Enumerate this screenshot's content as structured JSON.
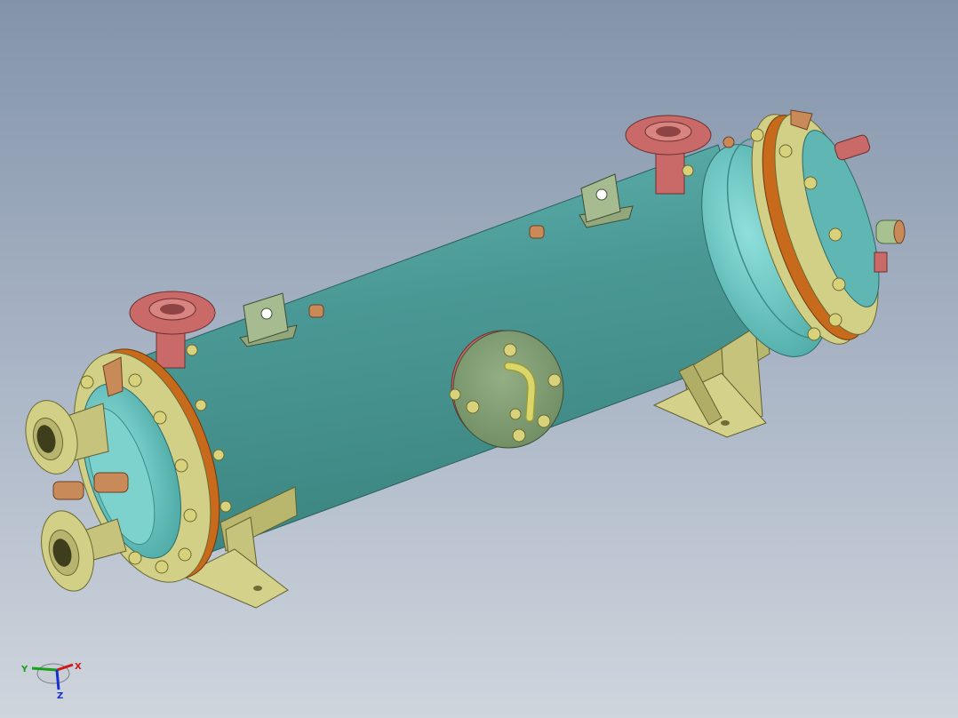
{
  "viewport": {
    "background_top": "#8394aa",
    "background_bottom": "#cfd5dd"
  },
  "model": {
    "parts": [
      "shell",
      "left-head",
      "right-head",
      "left-flange",
      "right-flange",
      "nozzle-top-left",
      "nozzle-top-right",
      "nozzle-left-upper",
      "nozzle-left-lower",
      "manhole-cover",
      "saddle-support-left",
      "saddle-support-right",
      "lifting-lug-left",
      "lifting-lug-right"
    ],
    "colors": {
      "shell": "#4a9895",
      "head": "#6cc8c4",
      "flange": "#d2cf86",
      "gasket": "#c86a1c",
      "nozzle": "#c96a68",
      "support": "#c6c47c",
      "lug": "#93a77d",
      "copper": "#c98a5a",
      "cover": "#7f9b70",
      "handle": "#d9d66a"
    }
  },
  "triad": {
    "x_label": "X",
    "y_label": "Y",
    "z_label": "Z",
    "x_color": "#d01818",
    "y_color": "#18a018",
    "z_color": "#1830d0"
  }
}
